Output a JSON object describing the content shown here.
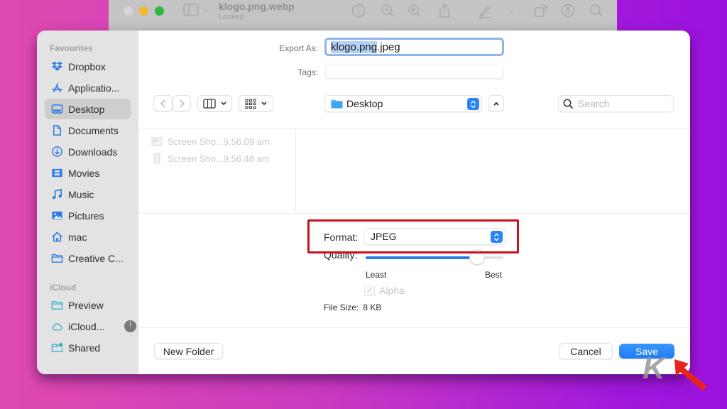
{
  "background_window": {
    "title": "klogo.png.webp",
    "subtitle": "Locked",
    "toolbar_icons": [
      "sidebar-toggle-icon",
      "info-icon",
      "zoom-out-icon",
      "zoom-in-icon",
      "share-icon",
      "markup-pen-icon",
      "rotate-icon",
      "annotate-icon",
      "search-icon"
    ]
  },
  "sidebar": {
    "sections": [
      {
        "title": "Favourites",
        "items": [
          {
            "label": "Dropbox",
            "icon": "dropbox-icon"
          },
          {
            "label": "Applicatio...",
            "icon": "applications-icon"
          },
          {
            "label": "Desktop",
            "icon": "desktop-icon",
            "selected": true
          },
          {
            "label": "Documents",
            "icon": "document-icon"
          },
          {
            "label": "Downloads",
            "icon": "download-icon"
          },
          {
            "label": "Movies",
            "icon": "film-icon"
          },
          {
            "label": "Music",
            "icon": "music-note-icon"
          },
          {
            "label": "Pictures",
            "icon": "photo-icon"
          },
          {
            "label": "mac",
            "icon": "home-icon"
          },
          {
            "label": "Creative C...",
            "icon": "folder-icon"
          }
        ]
      },
      {
        "title": "iCloud",
        "items": [
          {
            "label": "Preview",
            "icon": "folder-icon"
          },
          {
            "label": "iCloud...",
            "icon": "cloud-icon",
            "sync_progress_indicator": true
          },
          {
            "label": "Shared",
            "icon": "shared-folder-icon"
          }
        ]
      }
    ]
  },
  "form": {
    "export_as_label": "Export As:",
    "export_as_value_selected": "klogo.png",
    "export_as_value_rest": ".jpeg",
    "tags_label": "Tags:",
    "tags_value": ""
  },
  "toolbar": {
    "location": "Desktop",
    "search_placeholder": "Search"
  },
  "files": [
    {
      "name": "Screen Sho...9.56.09 am"
    },
    {
      "name": "Screen Sho...9.56.48 am"
    }
  ],
  "options": {
    "format_label": "Format:",
    "format_value": "JPEG",
    "quality_label": "Quality:",
    "quality_value": 0.81,
    "quality_min_label": "Least",
    "quality_max_label": "Best",
    "alpha_label": "Alpha",
    "alpha_checked": true,
    "alpha_enabled": false,
    "filesize_label": "File Size:",
    "filesize_value": "8 KB"
  },
  "buttons": {
    "new_folder": "New Folder",
    "cancel": "Cancel",
    "save": "Save"
  },
  "annotations": {
    "highlight_color": "#c8101e",
    "watermark": "K"
  },
  "colors": {
    "accent": "#2a84f5",
    "sidebar_icon": "#2b7be0",
    "icloud_icon": "#3bb0c9"
  }
}
